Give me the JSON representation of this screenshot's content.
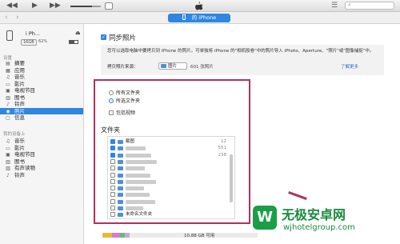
{
  "window": {
    "playback": {
      "rewind_icon": "rewind-icon",
      "play_icon": "play-icon",
      "forward_icon": "forward-icon"
    },
    "volume_level": 0.7,
    "list_icon": "list-icon",
    "search_icon": "search-icon"
  },
  "navbar": {
    "back_icon": "chevron-left-icon",
    "forward_icon": "chevron-right-icon",
    "device_label": "的 iPhone"
  },
  "sidebar": {
    "device": {
      "name": "i Ph...",
      "capacity": "16GB",
      "battery_text": "62%",
      "battery_level": 0.62
    },
    "section_settings": "设置",
    "settings_items": [
      {
        "label": "摘要",
        "icon": "summary-icon"
      },
      {
        "label": "应用",
        "icon": "apps-icon"
      },
      {
        "label": "音乐",
        "icon": "music-icon"
      },
      {
        "label": "影片",
        "icon": "movies-icon"
      },
      {
        "label": "电视节目",
        "icon": "tv-icon"
      },
      {
        "label": "图书",
        "icon": "books-icon"
      },
      {
        "label": "铃声",
        "icon": "bell-icon"
      },
      {
        "label": "照片",
        "icon": "camera-icon",
        "active": true
      },
      {
        "label": "信息",
        "icon": "info-icon"
      }
    ],
    "section_device": "我的设备上",
    "device_items": [
      {
        "label": "音乐",
        "icon": "music-icon"
      },
      {
        "label": "影片",
        "icon": "movies-icon"
      },
      {
        "label": "电视节目",
        "icon": "tv-icon"
      },
      {
        "label": "图书",
        "icon": "books-icon"
      },
      {
        "label": "有声读物",
        "icon": "audiobook-icon"
      },
      {
        "label": "铃声",
        "icon": "bell-icon"
      }
    ]
  },
  "main": {
    "sync_title": "同步照片",
    "description": "您可以选取电脑中要拷贝到 iPhone 的照片。可单独将 iPhone 的\"相机胶卷\"中的照片导入 iPhoto、Aperture、\"照片\"或\"图像捕捉\"中。",
    "copy_from_label": "拷贝照片来源：",
    "source_value": "图片",
    "source_count": "601 张照片",
    "learn_more": "了解更多",
    "options": {
      "all_folders": "所有文件夹",
      "selected_folders": "所选文件夹",
      "include_videos": "包括视频"
    },
    "folders_title": "文件夹",
    "folders": [
      {
        "name": "截图",
        "count": "12",
        "checked": true
      },
      {
        "name": "",
        "count": "551",
        "checked": true
      },
      {
        "name": "",
        "count": "238",
        "checked": true
      },
      {
        "name": "",
        "count": "",
        "checked": false
      },
      {
        "name": "",
        "count": "",
        "checked": false
      },
      {
        "name": "",
        "count": "",
        "checked": false
      },
      {
        "name": "",
        "count": "",
        "checked": false
      },
      {
        "name": "",
        "count": "",
        "checked": false
      },
      {
        "name": "",
        "count": "",
        "checked": false
      },
      {
        "name": "",
        "count": "",
        "checked": false
      },
      {
        "name": "",
        "count": "",
        "checked": false
      },
      {
        "name": "未命名文件夹",
        "count": "",
        "checked": false
      }
    ],
    "capacity_free": "10.88 GB 可用"
  },
  "watermark": {
    "title": "无极安卓网",
    "url": "wjhotelgroup.com"
  },
  "colors": {
    "accent": "#2f86e0",
    "highlight": "#b03060",
    "watermark": "#1b8a3e"
  }
}
